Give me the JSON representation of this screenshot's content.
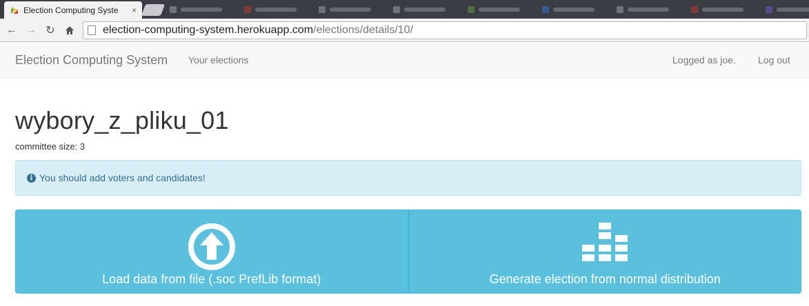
{
  "browser": {
    "active_tab_title": "Election Computing Syste",
    "url_host": "election-computing-system.herokuapp.com",
    "url_path": "/elections/details/10/",
    "tab_close": "×"
  },
  "navbar": {
    "brand": "Election Computing System",
    "your_elections": "Your elections",
    "logged_as": "Logged as joe.",
    "logout": "Log out"
  },
  "election": {
    "title": "wybory_z_pliku_01",
    "committee_size": "committee size: 3"
  },
  "alert": {
    "icon": "info-circle-icon",
    "message": "You should add voters and candidates!"
  },
  "actions": {
    "load_label": "Load data from file (.soc PrefLib format)",
    "load_icon": "upload-arrow-icon",
    "generate_label": "Generate election from normal distribution",
    "generate_icon": "bar-chart-distribution-icon"
  },
  "colors": {
    "info_button": "#5bc0de",
    "alert_bg": "#d9edf7",
    "alert_text": "#31708f"
  }
}
